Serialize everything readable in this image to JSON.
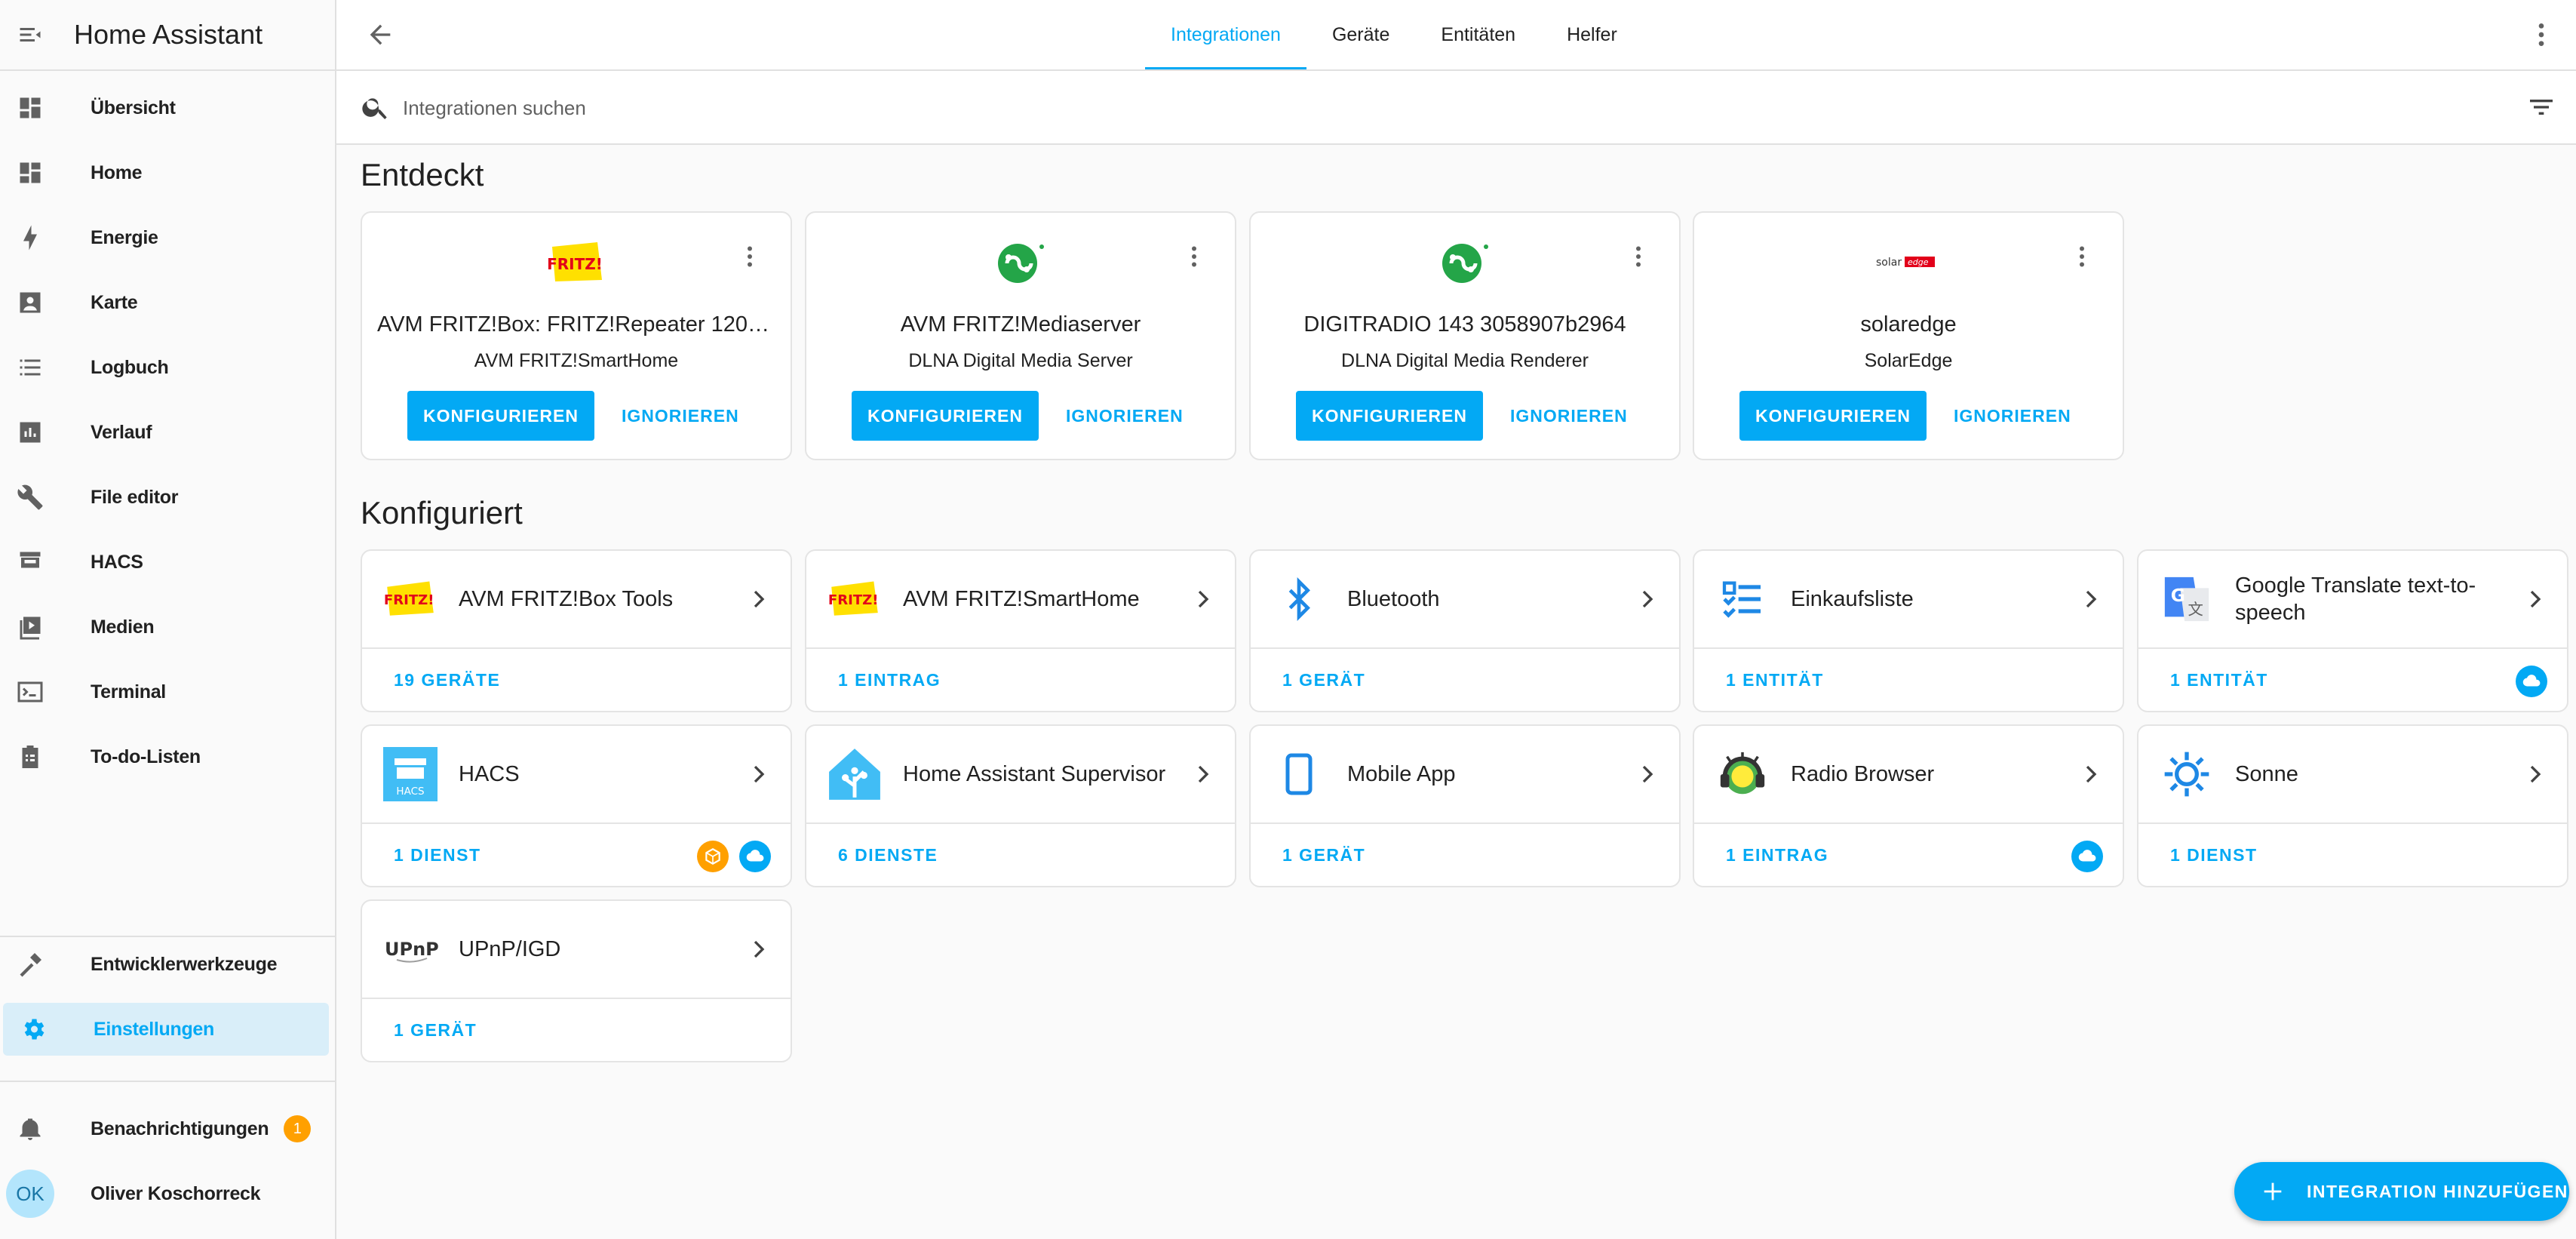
{
  "app_title": "Home Assistant",
  "sidebar": {
    "items": [
      {
        "label": "Übersicht",
        "icon": "dashboard-icon"
      },
      {
        "label": "Home",
        "icon": "dashboard-icon"
      },
      {
        "label": "Energie",
        "icon": "lightning-bolt-icon"
      },
      {
        "label": "Karte",
        "icon": "map-account-icon"
      },
      {
        "label": "Logbuch",
        "icon": "list-icon"
      },
      {
        "label": "Verlauf",
        "icon": "chart-box-icon"
      },
      {
        "label": "File editor",
        "icon": "wrench-icon"
      },
      {
        "label": "HACS",
        "icon": "hacs-icon"
      },
      {
        "label": "Medien",
        "icon": "play-box-icon"
      },
      {
        "label": "Terminal",
        "icon": "console-icon"
      },
      {
        "label": "To-do-Listen",
        "icon": "clipboard-list-icon"
      }
    ],
    "dev_tools": "Entwicklerwerkzeuge",
    "settings": "Einstellungen",
    "notifications": "Benachrichtigungen",
    "notifications_count": "1",
    "user_initials": "OK",
    "user_name": "Oliver Koschorreck"
  },
  "tabs": [
    "Integrationen",
    "Geräte",
    "Entitäten",
    "Helfer"
  ],
  "search": {
    "placeholder": "Integrationen suchen"
  },
  "discovered": {
    "title": "Entdeckt",
    "configure_label": "KONFIGURIEREN",
    "ignore_label": "IGNORIEREN",
    "cards": [
      {
        "name": "AVM FRITZ!Box: FRITZ!Repeater 1200 …",
        "subtitle": "AVM FRITZ!SmartHome",
        "logo": "fritz-logo"
      },
      {
        "name": "AVM FRITZ!Mediaserver",
        "subtitle": "DLNA Digital Media Server",
        "logo": "dlna-logo"
      },
      {
        "name": "DIGITRADIO 143 3058907b2964",
        "subtitle": "DLNA Digital Media Renderer",
        "logo": "dlna-logo"
      },
      {
        "name": "solaredge",
        "subtitle": "SolarEdge",
        "logo": "solaredge-logo"
      }
    ]
  },
  "configured": {
    "title": "Konfiguriert",
    "cards": [
      {
        "name": "AVM FRITZ!Box Tools",
        "count": "19 GERÄTE",
        "icon": "fritz-logo"
      },
      {
        "name": "AVM FRITZ!SmartHome",
        "count": "1 EINTRAG",
        "icon": "fritz-logo"
      },
      {
        "name": "Bluetooth",
        "count": "1 GERÄT",
        "icon": "bluetooth-icon"
      },
      {
        "name": "Einkaufsliste",
        "count": "1 ENTITÄT",
        "icon": "checklist-icon"
      },
      {
        "name": "Google Translate text-to-speech",
        "count": "1 ENTITÄT",
        "icon": "google-translate-icon"
      },
      {
        "name": "HACS",
        "count": "1 DIENST",
        "icon": "hacs-icon"
      },
      {
        "name": "Home Assistant Supervisor",
        "count": "6 DIENSTE",
        "icon": "home-assistant-icon"
      },
      {
        "name": "Mobile App",
        "count": "1 GERÄT",
        "icon": "mobile-phone-icon"
      },
      {
        "name": "Radio Browser",
        "count": "1 EINTRAG",
        "icon": "radio-browser-icon"
      },
      {
        "name": "Sonne",
        "count": "1 DIENST",
        "icon": "sun-icon"
      },
      {
        "name": "UPnP/IGD",
        "count": "1 GERÄT",
        "icon": "upnp-logo"
      }
    ]
  },
  "logo_text": {
    "fritz": "FRITZ!",
    "solaredge_a": "solar",
    "solaredge_b": "edge",
    "upnp": "UPnP",
    "hacs": "HACS"
  },
  "fab_label": "INTEGRATION HINZUFÜGEN",
  "colors": {
    "accent": "#03a9f4",
    "badge_orange": "#ffa000",
    "icon_grey": "#616161"
  }
}
